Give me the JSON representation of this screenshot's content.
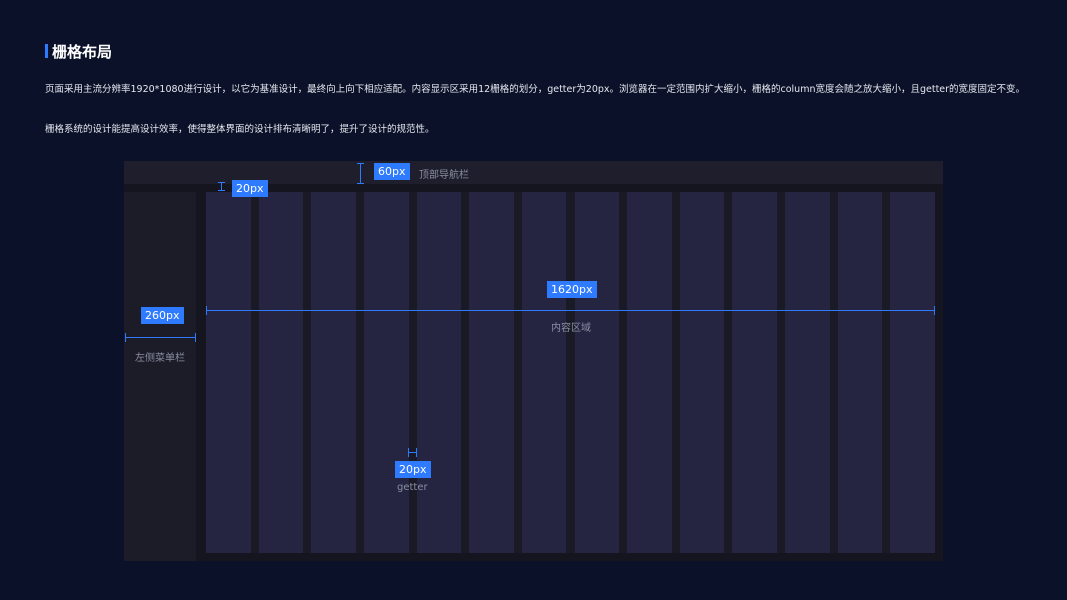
{
  "header": {
    "title": "栅格布局",
    "para1": "页面采用主流分辨率1920*1080进行设计，以它为基准设计，最终向上向下相应适配。内容显示区采用12栅格的划分，getter为20px。浏览器在一定范围内扩大缩小，栅格的column宽度会随之放大缩小，且getter的宽度固定不变。",
    "para2": "栅格系统的设计能提高设计效率，使得整体界面的设计排布清晰明了，提升了设计的规范性。"
  },
  "diagram": {
    "column_count": 14,
    "topnav": {
      "size": "60px",
      "label": "顶部导航栏"
    },
    "top_gap": {
      "size": "20px"
    },
    "sidebar": {
      "size": "260px",
      "label": "左侧菜单栏"
    },
    "content": {
      "size": "1620px",
      "label": "内容区域"
    },
    "gutter": {
      "size": "20px",
      "label": "getter"
    }
  },
  "colors": {
    "background": "#0a1128",
    "accent": "#2f7bff",
    "column": "#252542",
    "frame": "#15151f"
  }
}
